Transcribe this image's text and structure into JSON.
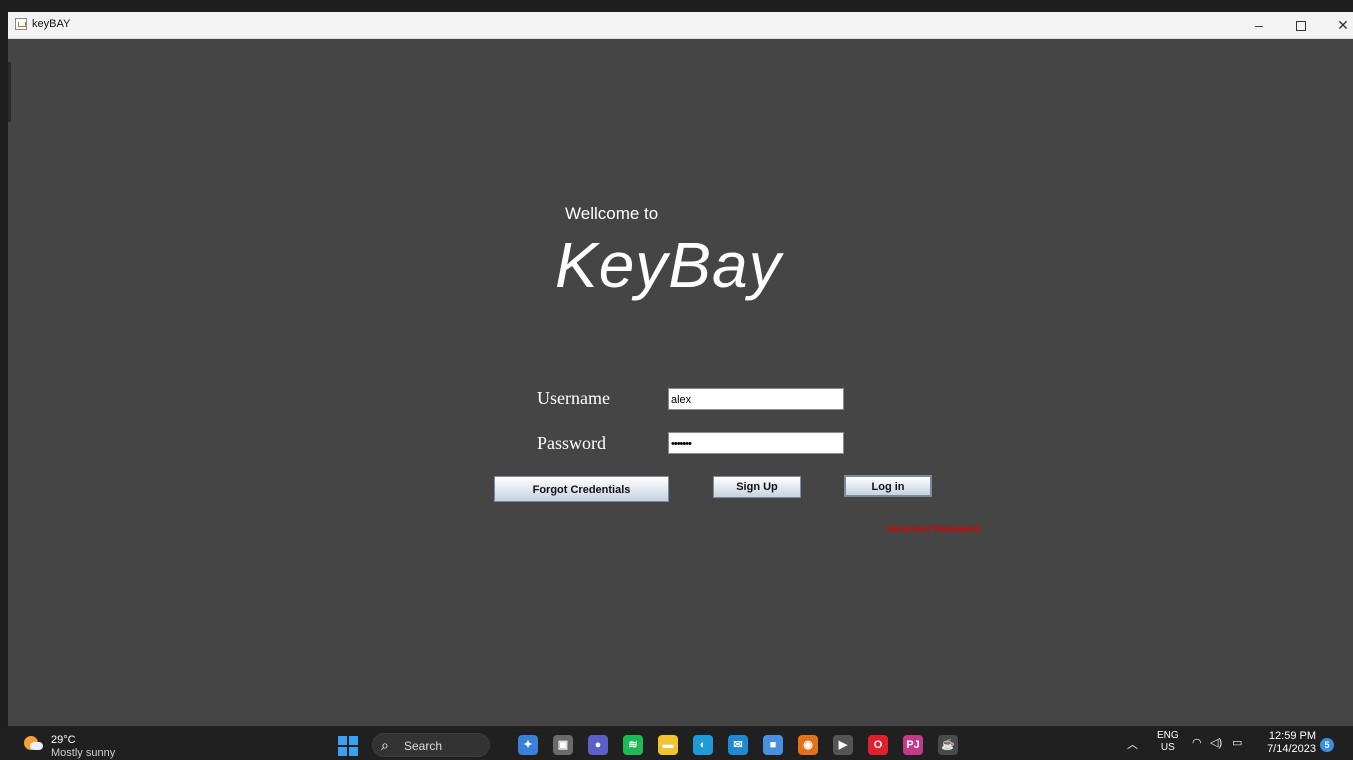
{
  "window": {
    "title": "keyBAY",
    "controls": {
      "minimize": "–",
      "close": "✕"
    }
  },
  "login": {
    "welcome": "Wellcome to",
    "brand": "KeyBay",
    "username_label": "Username",
    "username_value": "alex",
    "password_label": "Password",
    "password_value": "•••••••",
    "forgot_button": "Forgot Credentials",
    "signup_button": "Sign Up",
    "login_button": "Log in",
    "error_message": "Incorrect Password",
    "colors": {
      "background": "#454545",
      "error": "#e00000"
    }
  },
  "taskbar": {
    "weather": {
      "temp": "29°C",
      "condition": "Mostly sunny",
      "icon": "partly-sunny-icon"
    },
    "search_label": "Search",
    "apps": [
      {
        "name": "widgets-app",
        "glyph": "✦",
        "color": "#3b7fd6"
      },
      {
        "name": "task-view",
        "glyph": "▣",
        "color": "#6a6a6a"
      },
      {
        "name": "teams-chat",
        "glyph": "●",
        "color": "#5b5fc7"
      },
      {
        "name": "spotify",
        "glyph": "≋",
        "color": "#1db954"
      },
      {
        "name": "file-explorer",
        "glyph": "▬",
        "color": "#f2c230"
      },
      {
        "name": "edge",
        "glyph": "◐",
        "color": "#1e9ad6"
      },
      {
        "name": "mail",
        "glyph": "✉",
        "color": "#1f8ad2"
      },
      {
        "name": "store",
        "glyph": "■",
        "color": "#4a90e2"
      },
      {
        "name": "chrome-canary",
        "glyph": "◉",
        "color": "#e2711d"
      },
      {
        "name": "media-player",
        "glyph": "▶",
        "color": "#555555"
      },
      {
        "name": "opera",
        "glyph": "O",
        "color": "#e0202c"
      },
      {
        "name": "jetbrains",
        "glyph": "PJ",
        "color": "#c13b8a"
      },
      {
        "name": "java-app",
        "glyph": "☕",
        "color": "#4a4a4a"
      }
    ],
    "tray": {
      "lang_top": "ENG",
      "lang_bottom": "US",
      "time": "12:59 PM",
      "date": "7/14/2023",
      "notifications": "5"
    }
  }
}
